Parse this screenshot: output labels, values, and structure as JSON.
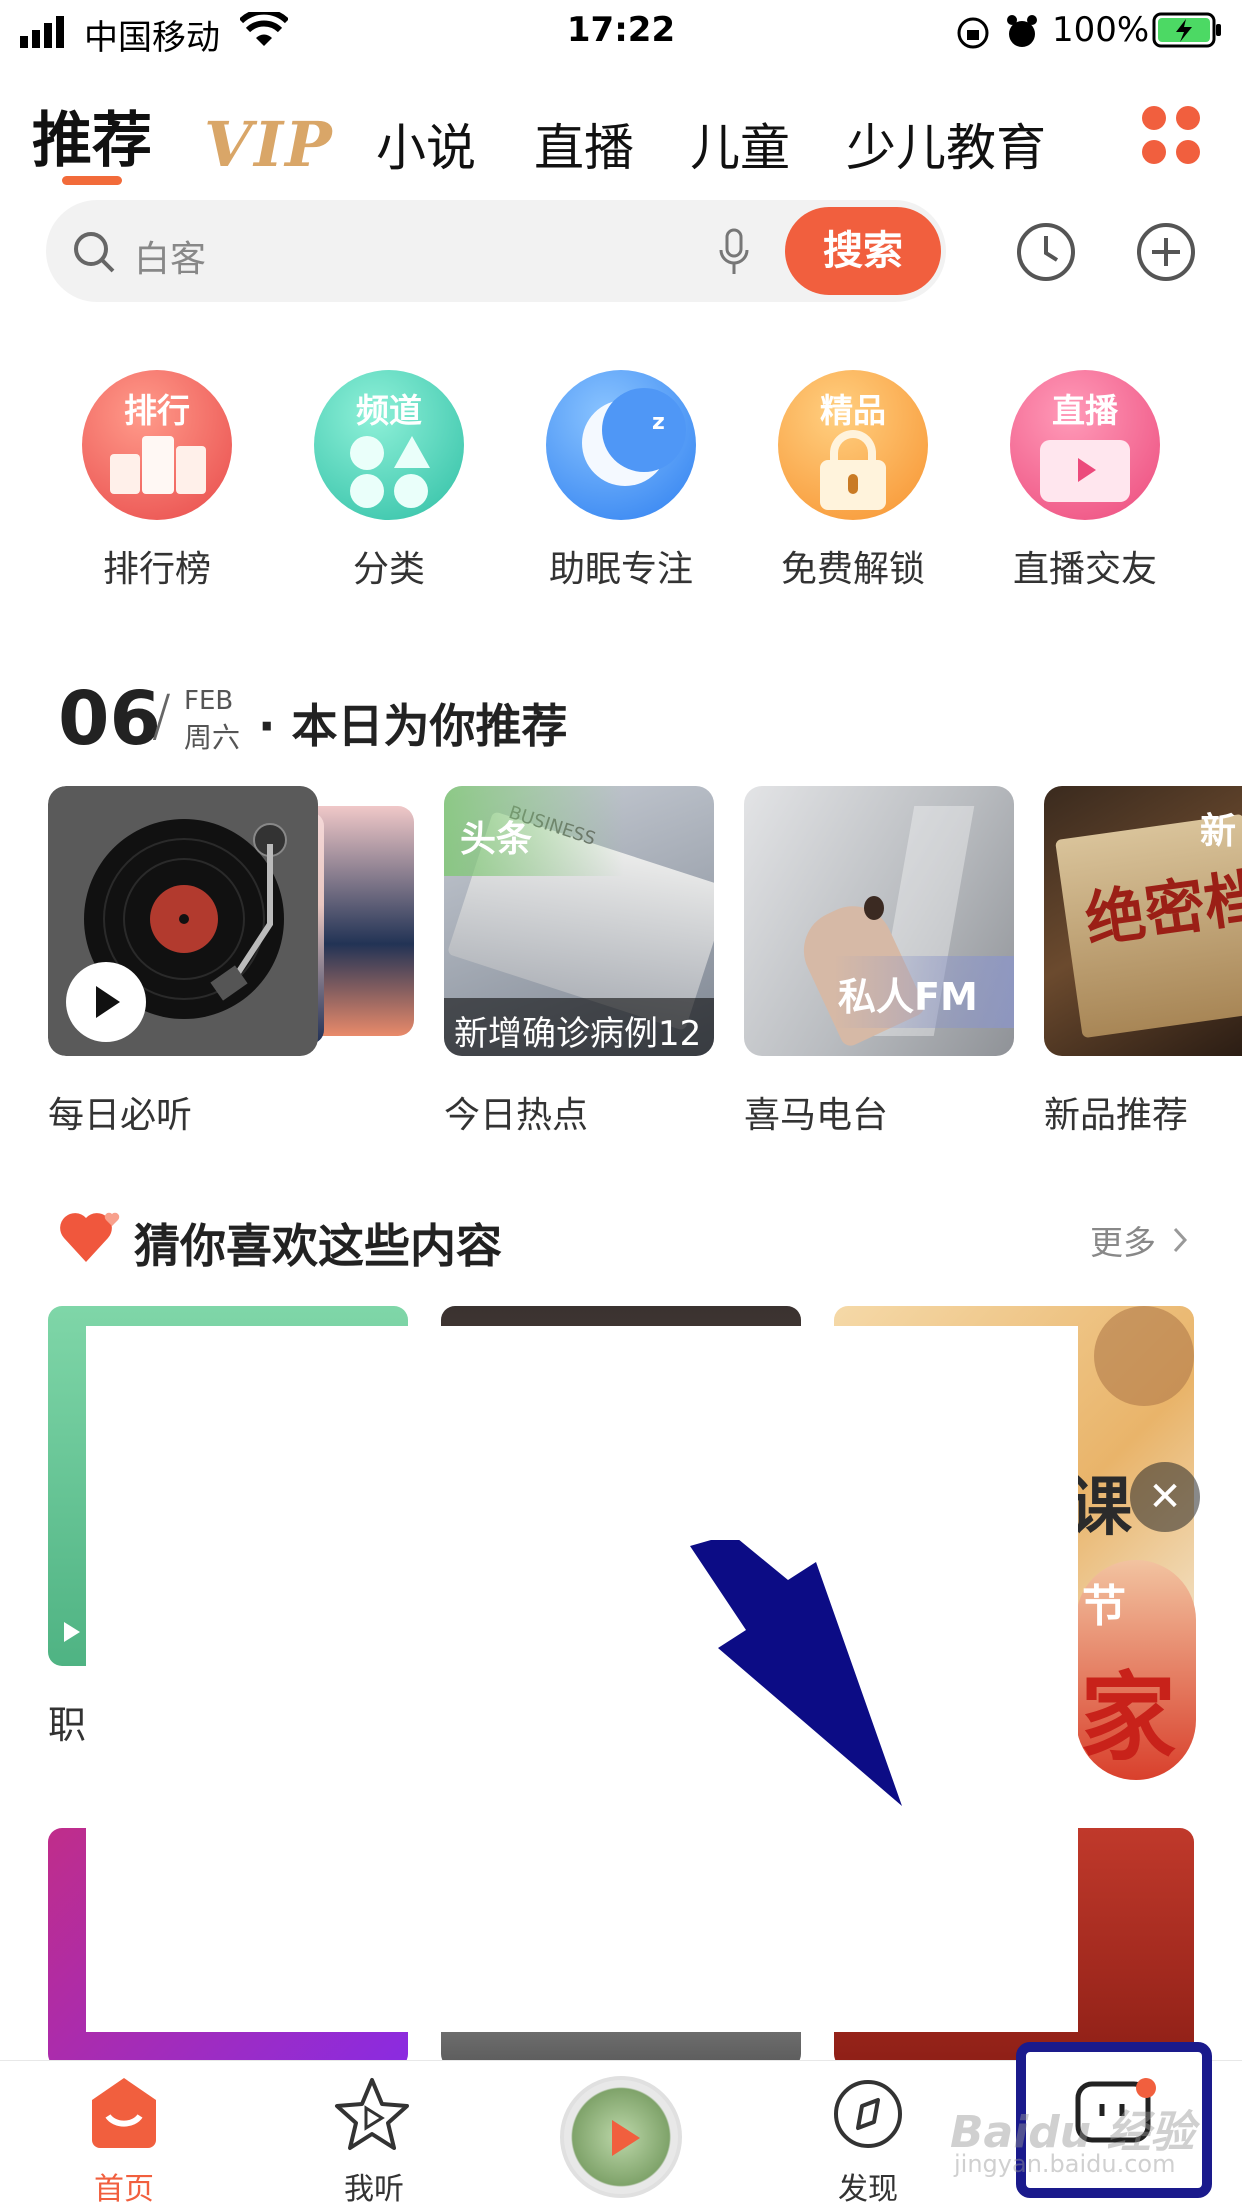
{
  "status_bar": {
    "carrier": "中国移动",
    "time": "17:22",
    "battery": "100%"
  },
  "top_tabs": {
    "items": [
      "推荐",
      "小说",
      "直播",
      "儿童",
      "少儿教育"
    ],
    "vip_label": "VIP",
    "accent_color": "#f26b3a"
  },
  "search": {
    "placeholder": "白客",
    "button_label": "搜索"
  },
  "quick_entries": [
    {
      "badge": "排行",
      "label": "排行榜",
      "icon": "podium-icon"
    },
    {
      "badge": "频道",
      "label": "分类",
      "icon": "category-icon"
    },
    {
      "badge": "",
      "label": "助眠专注",
      "icon": "moon-icon"
    },
    {
      "badge": "精品",
      "label": "免费解锁",
      "icon": "unlock-icon"
    },
    {
      "badge": "直播",
      "label": "直播交友",
      "icon": "tv-icon"
    }
  ],
  "daily": {
    "day": "06",
    "month": "FEB",
    "weekday": "周六",
    "title": "· 本日为你推荐",
    "cards": [
      {
        "label": "每日必听",
        "badge": ""
      },
      {
        "label": "今日热点",
        "badge": "头条",
        "caption": "新增确诊病例12"
      },
      {
        "label": "喜马电台",
        "badge": "私人FM"
      },
      {
        "label": "新品推荐",
        "badge": "新",
        "caption": "绝密档案"
      }
    ]
  },
  "recommend": {
    "title": "猜你喜欢这些内容",
    "more": "更多",
    "first_item_partial": "职",
    "partial_texts": [
      "课",
      "节",
      "家"
    ]
  },
  "bottom_nav": {
    "items": [
      "首页",
      "我听",
      "发现"
    ],
    "active_color": "#f15f3e"
  },
  "watermark": {
    "text": "Baidu 经验",
    "sub": "jingyan.baidu.com"
  }
}
